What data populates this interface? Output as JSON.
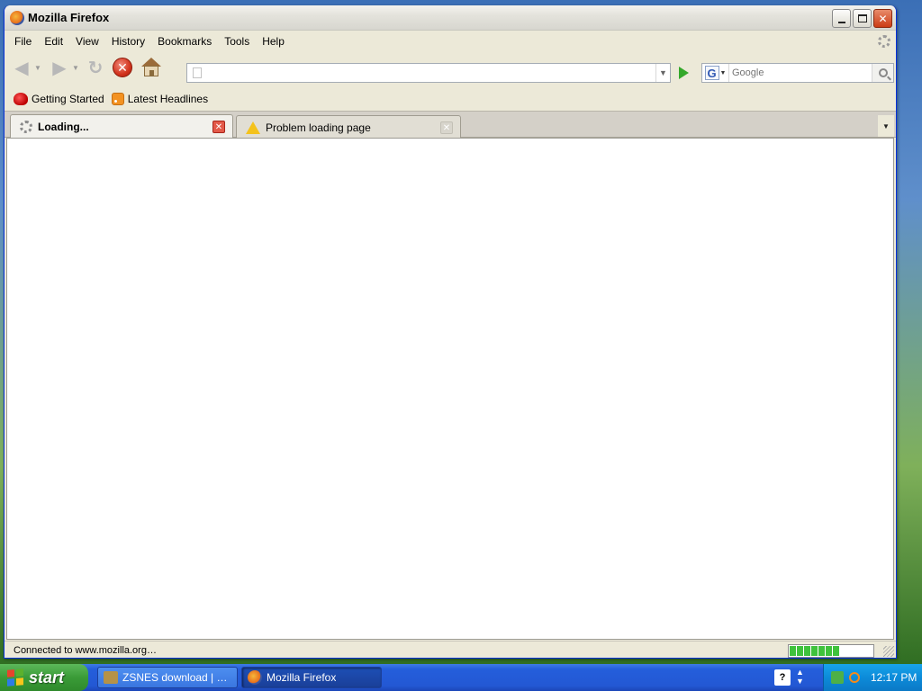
{
  "window": {
    "title": "Mozilla Firefox"
  },
  "menubar": {
    "items": [
      "File",
      "Edit",
      "View",
      "History",
      "Bookmarks",
      "Tools",
      "Help"
    ]
  },
  "navbar": {
    "url_value": "",
    "search_engine": "G",
    "search_placeholder": "Google"
  },
  "bookmarks": {
    "items": [
      {
        "label": "Getting Started",
        "icon": "firefox-bookmark-icon"
      },
      {
        "label": "Latest Headlines",
        "icon": "rss-feed-icon"
      }
    ]
  },
  "tabs": [
    {
      "label": "Loading...",
      "active": true,
      "icon": "loading-spinner-icon"
    },
    {
      "label": "Problem loading page",
      "active": false,
      "icon": "warning-icon"
    }
  ],
  "statusbar": {
    "text": "Connected to www.mozilla.org…",
    "progress_percent": 65
  },
  "taskbar": {
    "start_label": "start",
    "tasks": [
      {
        "label": "ZSNES download | So...",
        "icon": "zsnes-icon",
        "active": false
      },
      {
        "label": "Mozilla Firefox",
        "icon": "firefox-icon",
        "active": true
      }
    ],
    "lang_indicator": "?",
    "clock": "12:17 PM"
  },
  "colors": {
    "titlebar": "#ece9d8",
    "taskbar": "#245edb",
    "start_button": "#3a9b37",
    "tray": "#0c8bd9",
    "progress_fill": "#3fc23c"
  }
}
